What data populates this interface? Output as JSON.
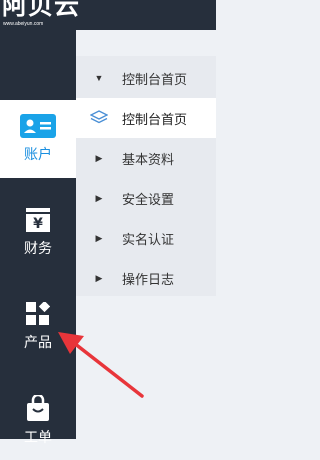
{
  "header": {
    "logo_text": "阿贝云",
    "logo_domain": "www.abeiyun.com"
  },
  "sidebar": {
    "items": [
      {
        "label": "账户",
        "icon": "id-card-icon",
        "active": true
      },
      {
        "label": "财务",
        "icon": "yuan-wallet-icon",
        "active": false
      },
      {
        "label": "产品",
        "icon": "grid-blocks-icon",
        "active": false
      },
      {
        "label": "工单",
        "icon": "shopping-bag-icon",
        "active": false
      }
    ]
  },
  "submenu": {
    "items": [
      {
        "label": "控制台首页",
        "state": "expanded",
        "icon": "caret-down-icon"
      },
      {
        "label": "控制台首页",
        "state": "current",
        "icon": "layers-icon"
      },
      {
        "label": "基本资料",
        "state": "collapsed",
        "icon": "caret-right-icon"
      },
      {
        "label": "安全设置",
        "state": "collapsed",
        "icon": "caret-right-icon"
      },
      {
        "label": "实名认证",
        "state": "collapsed",
        "icon": "caret-right-icon"
      },
      {
        "label": "操作日志",
        "state": "collapsed",
        "icon": "caret-right-icon"
      }
    ]
  },
  "colors": {
    "sidebar_bg": "#262f3c",
    "accent": "#1a8fe0",
    "submenu_bg": "#e7eaef",
    "annotation_arrow": "#e8353a"
  }
}
